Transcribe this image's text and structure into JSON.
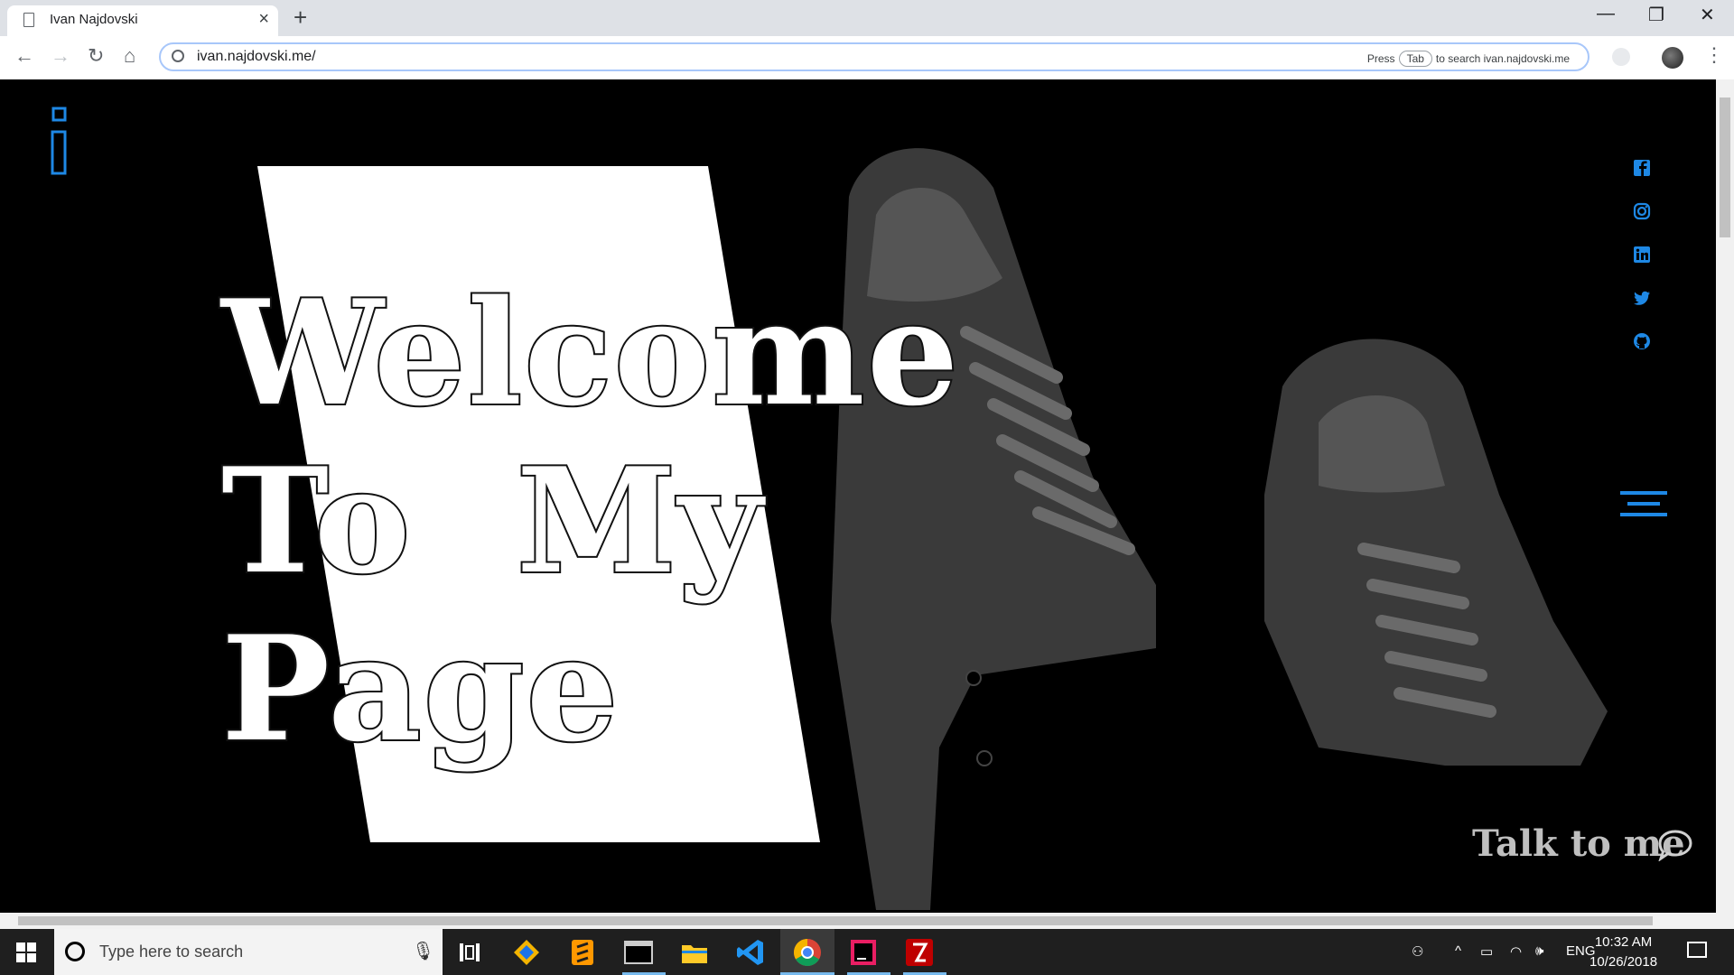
{
  "browser": {
    "tab_title": "Ivan Najdovski",
    "new_tab": "+",
    "url": "ivan.najdovski.me/",
    "search_hint_prefix": "Press",
    "search_hint_key": "Tab",
    "search_hint_suffix": "to search ivan.najdovski.me",
    "window_controls": [
      "—",
      "❐",
      "✕"
    ]
  },
  "page": {
    "headline_lines": [
      "Welcome",
      "To  My",
      "Page"
    ],
    "talk_label": "Talk to me",
    "social_icons": [
      "facebook-icon",
      "instagram-icon",
      "linkedin-icon",
      "twitter-icon",
      "github-icon"
    ],
    "accent_color": "#1e88e5"
  },
  "taskbar": {
    "search_placeholder": "Type here to search",
    "language": "ENG",
    "time": "10:32 AM",
    "date": "10/26/2018",
    "apps": [
      "task-view-icon",
      "git-icon",
      "sublime-text-icon",
      "terminal-icon",
      "file-explorer-icon",
      "vscode-icon",
      "chrome-icon",
      "intellij-icon",
      "filezilla-icon"
    ]
  }
}
